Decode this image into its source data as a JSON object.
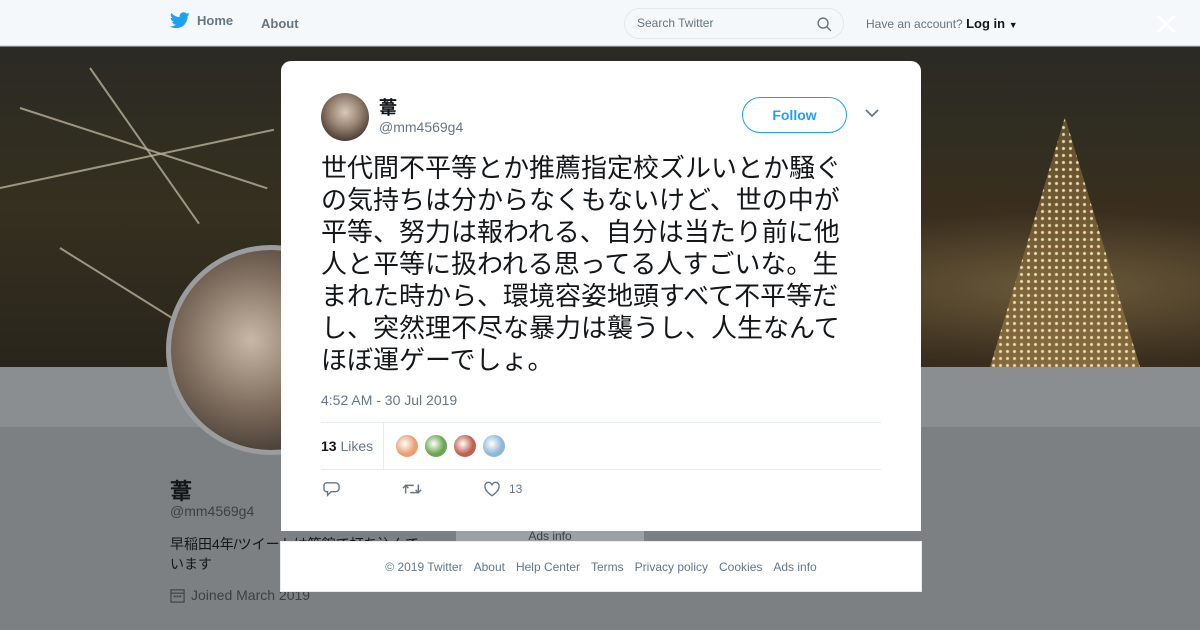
{
  "topbar": {
    "home_label": "Home",
    "about_label": "About",
    "search_placeholder": "Search Twitter",
    "account_prompt": "Have an account?",
    "login_label": "Log in"
  },
  "profile": {
    "name": "葦",
    "handle": "@mm4569g4",
    "bio": "早稲田4年/ツイートは箱館で打ち込んでいます",
    "joined": "Joined March 2019",
    "ads_info": "Ads info"
  },
  "tweet": {
    "author_name": "葦",
    "author_handle": "@mm4569g4",
    "follow_label": "Follow",
    "lines": [
      "世代間不平等とか推薦指定校ズルいとか騒ぐ",
      "の気持ちは分からなくもないけど、世の中が",
      "平等、努力は報われる、自分は当たり前に他",
      "人と平等に扱われる思ってる人すごいな。生",
      "まれた時から、環境容姿地頭すべて不平等だ",
      "し、突然理不尽な暴力は襲うし、人生なんて",
      "ほぼ運ゲーでしょ。"
    ],
    "timestamp": "4:52 AM - 30 Jul 2019",
    "likes_count": "13",
    "likes_label": "Likes",
    "like_action_count": "13",
    "liker_colors": [
      "#e8a070",
      "#6aa84f",
      "#c06050",
      "#8fb8d8"
    ]
  },
  "footer": {
    "links": [
      "© 2019 Twitter",
      "About",
      "Help Center",
      "Terms",
      "Privacy policy",
      "Cookies",
      "Ads info"
    ]
  },
  "colors": {
    "brand_blue": "#1da1f2",
    "text_primary": "#14171a",
    "text_secondary": "#657786"
  }
}
